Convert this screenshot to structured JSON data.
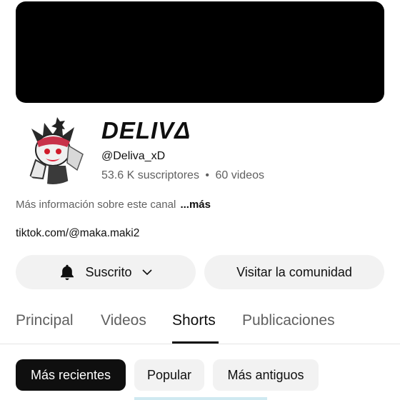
{
  "channel": {
    "name": "DELIVΔ",
    "handle": "@Deliva_xD",
    "subscribers": "53.6 K suscriptores",
    "separator": "•",
    "videos": "60 videos",
    "about": "Más información sobre este canal",
    "about_more": "...más",
    "link": "tiktok.com/@maka.maki2"
  },
  "actions": {
    "subscribe_label": "Suscrito",
    "community_label": "Visitar la comunidad"
  },
  "tabs": [
    {
      "label": "Principal",
      "active": false
    },
    {
      "label": "Videos",
      "active": false
    },
    {
      "label": "Shorts",
      "active": true
    },
    {
      "label": "Publicaciones",
      "active": false
    }
  ],
  "filters": [
    {
      "label": "Más recientes",
      "selected": true
    },
    {
      "label": "Popular",
      "selected": false
    },
    {
      "label": "Más antiguos",
      "selected": false
    }
  ],
  "icons": {
    "bell": "bell-icon",
    "chevron": "chevron-down-icon"
  },
  "colors": {
    "banner": "#000000",
    "pill_bg": "#f2f2f2",
    "selected_chip": "#0f0f0f",
    "secondary_text": "#606060"
  }
}
